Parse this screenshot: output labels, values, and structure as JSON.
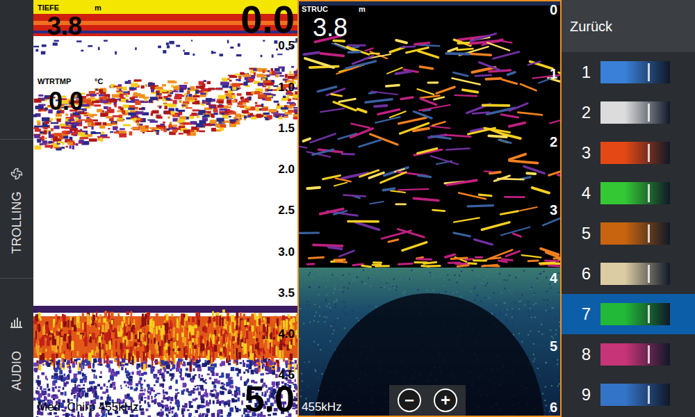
{
  "sidebar": {
    "tabs": [
      {
        "label": "TROLLING",
        "selected": false
      },
      {
        "label": "AUDIO",
        "selected": false
      }
    ]
  },
  "sonar": {
    "depth_label": "TIEFE",
    "depth_unit": "m",
    "depth": "3.8",
    "range_top": "0.0",
    "range_bottom": "5.0",
    "temp_label": "WTRTMP",
    "temp_unit": "°C",
    "temp": "0.0",
    "scale": [
      "0.5",
      "1.0",
      "1.5",
      "2.0",
      "2.5",
      "3.0",
      "3.5",
      "4.0",
      "4.5"
    ],
    "mode": "Med. Chirp 455kHz"
  },
  "structure": {
    "label": "STRUC",
    "unit": "m",
    "depth": "3.8",
    "scale": [
      "0",
      "1",
      "2",
      "3",
      "4",
      "5",
      "6"
    ],
    "frequency": "455kHz",
    "zoom_out": "−",
    "zoom_in": "+",
    "selected": true
  },
  "palette_menu": {
    "back": "Zurück",
    "items": [
      {
        "number": "1",
        "selected": false,
        "color": "#3a80d8"
      },
      {
        "number": "2",
        "selected": false,
        "color": "#dcdcdc"
      },
      {
        "number": "3",
        "selected": false,
        "color": "#e44814"
      },
      {
        "number": "4",
        "selected": false,
        "color": "#34c834"
      },
      {
        "number": "5",
        "selected": false,
        "color": "#c8640f"
      },
      {
        "number": "6",
        "selected": false,
        "color": "#dccca4"
      },
      {
        "number": "7",
        "selected": true,
        "color": "#22b838"
      },
      {
        "number": "8",
        "selected": false,
        "color": "#c83478"
      },
      {
        "number": "9",
        "selected": false,
        "color": "#3474c8"
      }
    ]
  }
}
